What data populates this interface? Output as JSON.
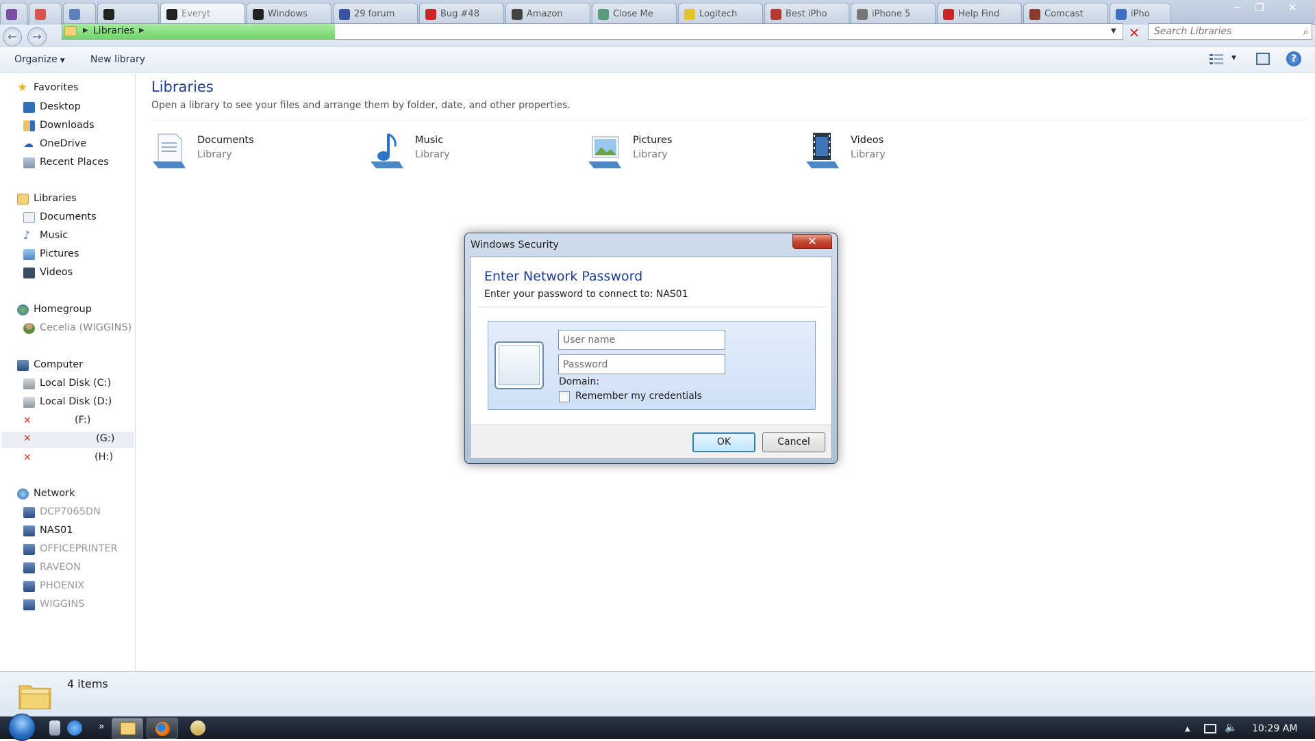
{
  "window": {
    "minimize_glyph": "─",
    "maximize_glyph": "❐",
    "close_glyph": "✕"
  },
  "browser_tabs": [
    {
      "label": "",
      "color": "#7b4fa3"
    },
    {
      "label": "",
      "color": "#d9534f"
    },
    {
      "label": "",
      "color": "#5c7fbf"
    },
    {
      "label": "",
      "color": "#222222"
    },
    {
      "label": "Everyt",
      "color": "#222222"
    },
    {
      "label": "Windows",
      "color": "#222222"
    },
    {
      "label": "29 forum",
      "color": "#3b52a0"
    },
    {
      "label": "Bug #48",
      "color": "#c62828"
    },
    {
      "label": "Amazon",
      "color": "#444444"
    },
    {
      "label": "Close Me",
      "color": "#5b9b7b"
    },
    {
      "label": "Logitech",
      "color": "#e0c230"
    },
    {
      "label": "Best iPho",
      "color": "#b33b2e"
    },
    {
      "label": "iPhone 5",
      "color": "#777777"
    },
    {
      "label": "Help Find",
      "color": "#c62828"
    },
    {
      "label": "Comcast",
      "color": "#8b3b2e"
    },
    {
      "label": "iPho",
      "color": "#3f6fc2"
    }
  ],
  "address_bar": {
    "path": "Libraries",
    "search_placeholder": "Search Libraries",
    "back_glyph": "←",
    "forward_glyph": "→",
    "stop_glyph": "✕"
  },
  "command_bar": {
    "organize": "Organize",
    "new_library": "New library",
    "help_glyph": "?"
  },
  "nav": {
    "favorites": {
      "header": "Favorites",
      "items": [
        "Desktop",
        "Downloads",
        "OneDrive",
        "Recent Places"
      ]
    },
    "libraries": {
      "header": "Libraries",
      "items": [
        "Documents",
        "Music",
        "Pictures",
        "Videos"
      ]
    },
    "homegroup": {
      "header": "Homegroup",
      "items": [
        "Cecelia (WIGGINS)"
      ]
    },
    "computer": {
      "header": "Computer",
      "items": [
        "Local Disk (C:)",
        "Local Disk (D:)",
        "(F:)",
        "(G:)",
        "(H:)"
      ]
    },
    "network": {
      "header": "Network",
      "items": [
        "DCP7065DN",
        "NAS01",
        "OFFICEPRINTER",
        "RAVEON",
        "PHOENIX",
        "WIGGINS"
      ]
    }
  },
  "content": {
    "title": "Libraries",
    "subtitle": "Open a library to see your files and arrange them by folder, date, and other properties.",
    "libraries": [
      {
        "name": "Documents",
        "kind": "Library"
      },
      {
        "name": "Music",
        "kind": "Library"
      },
      {
        "name": "Pictures",
        "kind": "Library"
      },
      {
        "name": "Videos",
        "kind": "Library"
      }
    ]
  },
  "status_bar": {
    "item_count": "4 items"
  },
  "taskbar": {
    "clock": "10:29 AM",
    "overflow_glyph": "»",
    "tray_up_glyph": "▲"
  },
  "dialog": {
    "title": "Windows Security",
    "close_glyph": "✕",
    "heading": "Enter Network Password",
    "subtitle": "Enter your password to connect to: NAS01",
    "username_placeholder": "User name",
    "password_placeholder": "Password",
    "domain_label": "Domain:",
    "domain_value": "",
    "remember_label": "Remember my credentials",
    "ok_label": "OK",
    "cancel_label": "Cancel"
  },
  "colors": {
    "accent_blue": "#1e3d8f",
    "address_progress_green": "#6fd46a",
    "dialog_close_red": "#c44a33"
  }
}
